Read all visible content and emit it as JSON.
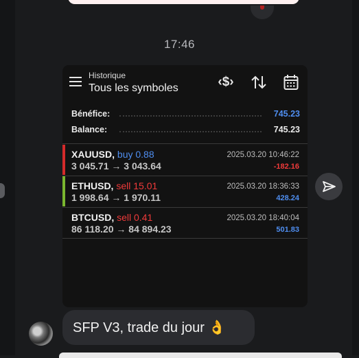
{
  "timestamp": "17:46",
  "message": {
    "text": "SFP V3, trade du jour 👌"
  },
  "screenshot": {
    "header": {
      "subtitle": "Historique",
      "title": "Tous les symboles",
      "icons": [
        "menu-icon",
        "dollar-exchange-icon",
        "sort-icon",
        "calendar-icon"
      ]
    },
    "summary": {
      "profit_label": "Bénéfice:",
      "profit_value": "745.23",
      "balance_label": "Balance:",
      "balance_value": "745.23"
    },
    "trades": [
      {
        "symbol": "XAUUSD,",
        "side": "buy 0.88",
        "prices": "3 045.71 → 3 043.64",
        "date": "2025.03.20 10:46:22",
        "profit": "-182.16"
      },
      {
        "symbol": "ETHUSD,",
        "side": "sell 15.01",
        "prices": "1 998.64 → 1 970.11",
        "date": "2025.03.20 18:36:33",
        "profit": "428.24"
      },
      {
        "symbol": "BTCUSD,",
        "side": "sell 0.41",
        "prices": "86 118.20 → 84 894.23",
        "date": "2025.03.20 18:40:04",
        "profit": "501.83"
      }
    ],
    "colors": {
      "buy": "#4f8ef0",
      "sell": "#ef3a3a",
      "profit_positive": "#4f8ef0",
      "profit_negative": "#ef3a3a",
      "bar_loss": "#d42a2a",
      "bar_gain": "#7ab62f"
    }
  }
}
